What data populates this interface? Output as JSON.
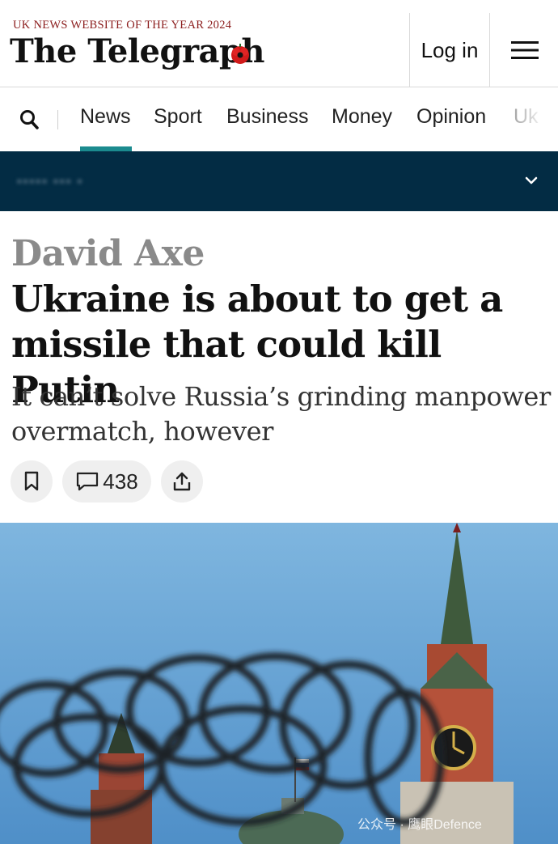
{
  "header": {
    "award_text": "UK NEWS WEBSITE OF THE YEAR 2024",
    "logo_text": "The Telegraph",
    "login_label": "Log in",
    "menu_icon": "hamburger-menu-icon",
    "poppy_color": "#d11a1a"
  },
  "nav": {
    "search_icon": "search-icon",
    "items": [
      "News",
      "Sport",
      "Business",
      "Money",
      "Opinion",
      "Uk"
    ],
    "active_index": 0,
    "accent_color": "#1b8b8f"
  },
  "band": {
    "background": "#032c44",
    "chevron_icon": "chevron-down-icon"
  },
  "article": {
    "author": "David Axe",
    "headline": "Ukraine is about to get a missile that could kill Putin",
    "standfirst": "It can’t solve Russia’s grinding manpower overmatch, however",
    "comment_count": "438",
    "bookmark_icon": "bookmark-icon",
    "comment_icon": "comment-icon",
    "share_icon": "share-icon"
  },
  "image": {
    "watermark": "公众号 · 鹰眼Defence"
  }
}
